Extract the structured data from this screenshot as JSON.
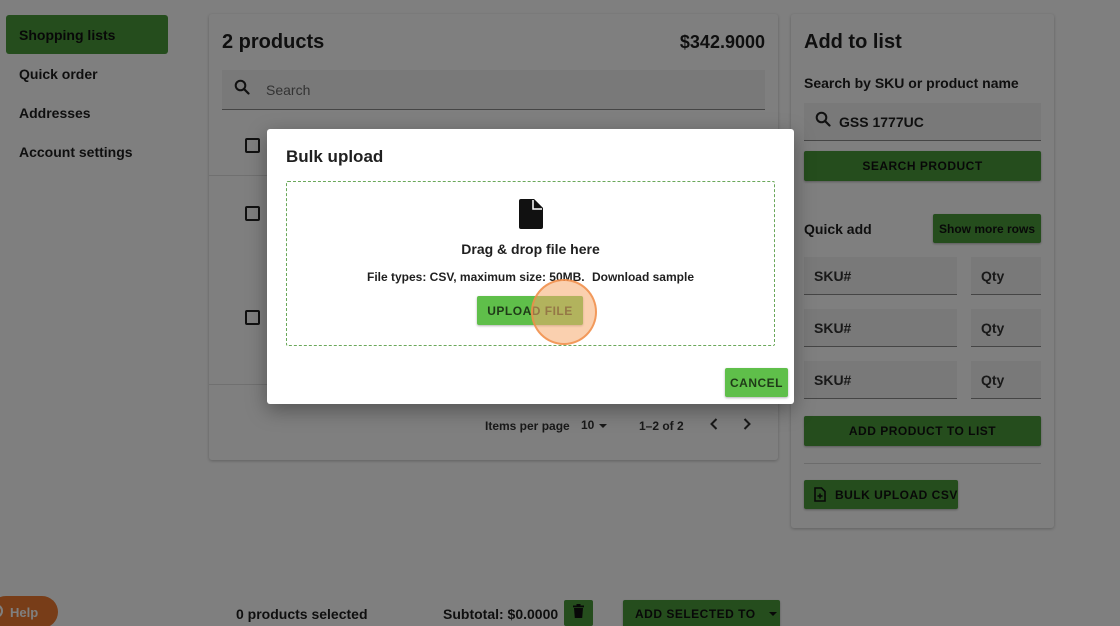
{
  "sidebar": {
    "items": [
      {
        "label": "Shopping lists",
        "active": true
      },
      {
        "label": "Quick order",
        "active": false
      },
      {
        "label": "Addresses",
        "active": false
      },
      {
        "label": "Account settings",
        "active": false
      }
    ]
  },
  "products": {
    "title": "2 products",
    "total": "$342.9000",
    "search_placeholder": "Search",
    "pagination": {
      "items_per_page_label": "Items per page",
      "items_per_page_value": "10",
      "range": "1–2 of 2"
    }
  },
  "add_to_list": {
    "title": "Add to list",
    "search_label": "Search by SKU or product name",
    "search_value": "GSS 1777UC",
    "search_button": "SEARCH PRODUCT",
    "quick_add_label": "Quick add",
    "show_more_button": "Show more rows",
    "sku_placeholder": "SKU#",
    "qty_placeholder": "Qty",
    "add_product_button": "ADD PRODUCT TO LIST",
    "bulk_upload_button": "BULK UPLOAD CSV"
  },
  "bottom_bar": {
    "selected": "0 products selected",
    "subtotal": "Subtotal: $0.0000",
    "add_selected_button": "ADD SELECTED TO"
  },
  "help": {
    "label": "Help"
  },
  "modal": {
    "title": "Bulk upload",
    "drop_title": "Drag & drop file here",
    "file_info": "File types: CSV, maximum size: 50MB.",
    "download_sample": "Download sample",
    "upload_button": "UPLOAD FILE",
    "cancel_button": "CANCEL"
  },
  "colors": {
    "accent_green": "#4a9a3a",
    "button_green": "#5fbf4a",
    "help_orange": "#f07b30"
  }
}
